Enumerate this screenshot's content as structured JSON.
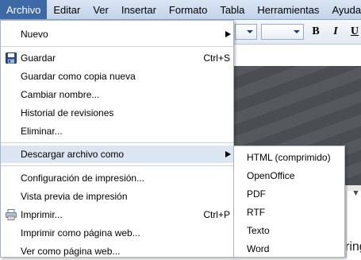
{
  "menubar": {
    "items": [
      {
        "label": "Archivo"
      },
      {
        "label": "Editar"
      },
      {
        "label": "Ver"
      },
      {
        "label": "Insertar"
      },
      {
        "label": "Formato"
      },
      {
        "label": "Tabla"
      },
      {
        "label": "Herramientas"
      },
      {
        "label": "Ayuda"
      }
    ]
  },
  "toolbar": {
    "bold_label": "B",
    "italic_label": "I",
    "underline_label": "U"
  },
  "file_menu": {
    "nuevo": "Nuevo",
    "guardar": "Guardar",
    "guardar_shortcut": "Ctrl+S",
    "guardar_copia": "Guardar como copia nueva",
    "cambiar_nombre": "Cambiar nombre...",
    "historial": "Historial de revisiones",
    "eliminar": "Eliminar...",
    "descargar": "Descargar archivo como",
    "config_impresion": "Configuración de impresión...",
    "vista_previa": "Vista previa de impresión",
    "imprimir": "Imprimir...",
    "imprimir_shortcut": "Ctrl+P",
    "imprimir_web": "Imprimir como página web...",
    "ver_web": "Ver como página web..."
  },
  "download_submenu": {
    "items": [
      {
        "label": "HTML (comprimido)"
      },
      {
        "label": "OpenOffice"
      },
      {
        "label": "PDF"
      },
      {
        "label": "RTF"
      },
      {
        "label": "Texto"
      },
      {
        "label": "Word"
      }
    ]
  },
  "document": {
    "text_fragment": "ring"
  },
  "colors": {
    "menubar_active": "#3d6aa6",
    "menu_highlight": "#dce6f2"
  }
}
